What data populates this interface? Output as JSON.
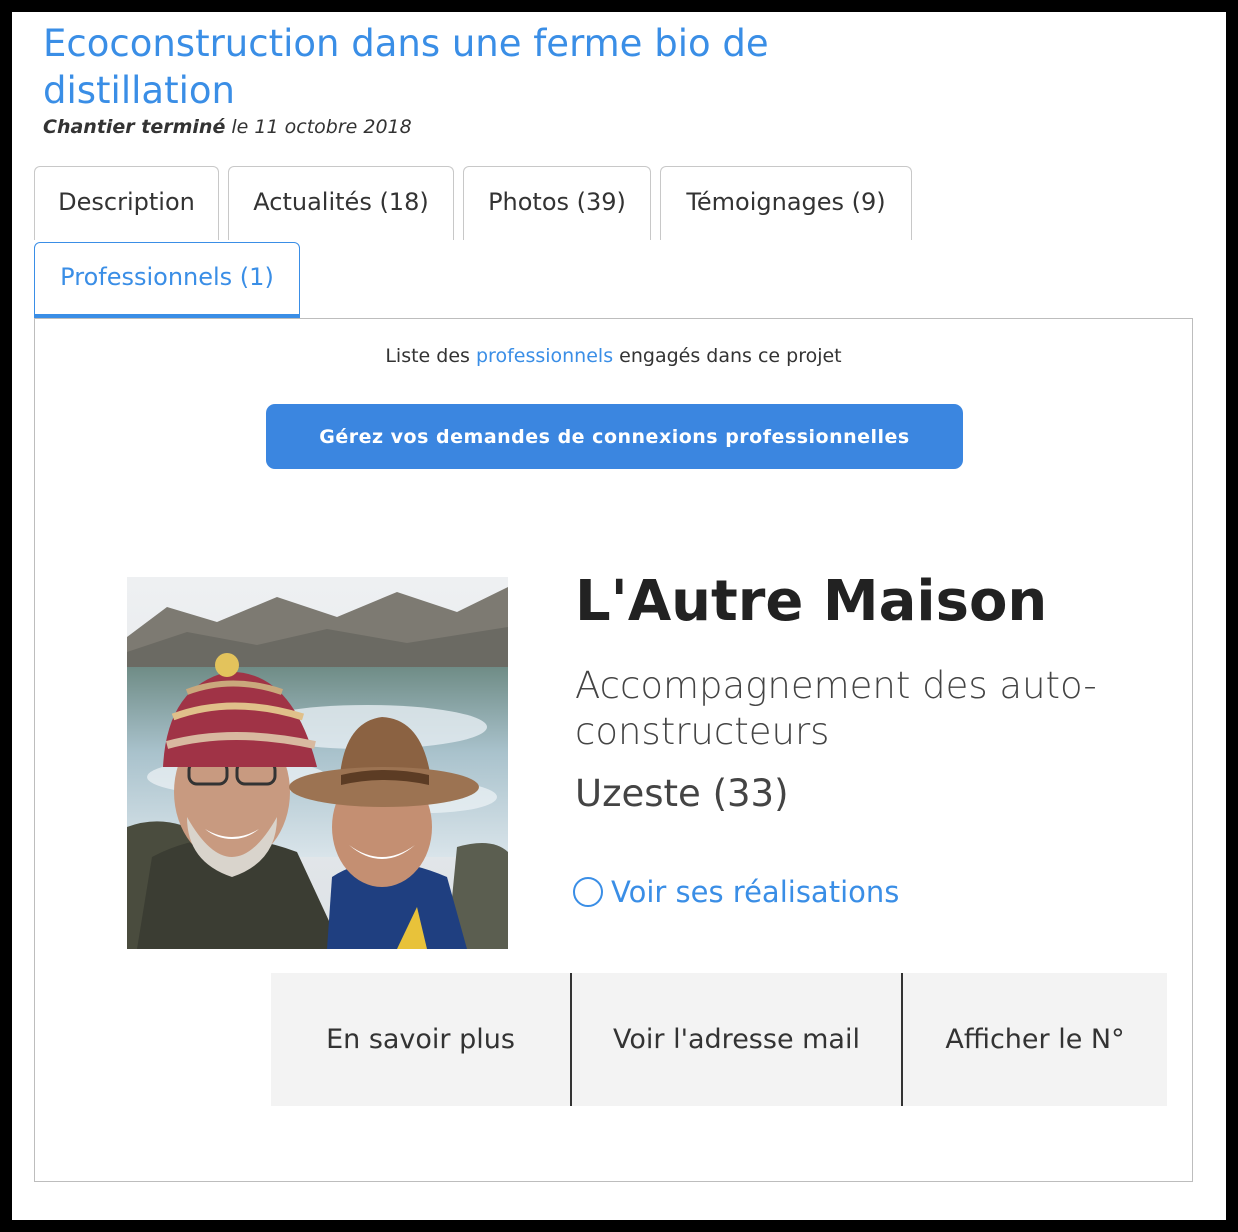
{
  "project": {
    "title": "Ecoconstruction dans une ferme bio de distillation",
    "status": "Chantier terminé",
    "date_text": "le 11 octobre 2018"
  },
  "tabs": [
    {
      "label": "Description",
      "active": false
    },
    {
      "label": "Actualités (18)",
      "active": false
    },
    {
      "label": "Photos (39)",
      "active": false
    },
    {
      "label": "Témoignages (9)",
      "active": false
    },
    {
      "label": "Professionnels (1)",
      "active": true
    }
  ],
  "panel": {
    "intro_before": "Liste des ",
    "intro_link": "professionnels",
    "intro_after": " engagés dans ce projet",
    "manage_button": "Gérez vos demandes de connexions professionnelles"
  },
  "professional": {
    "name": "L'Autre Maison",
    "activity": "Accompagnement des auto-constructeurs",
    "location": "Uzeste (33)",
    "realisations_link": "Voir ses réalisations",
    "realisations_icon": "circle-icon",
    "actions": {
      "more": "En savoir plus",
      "email": "Voir l'adresse mail",
      "phone": "Afficher le N°"
    }
  },
  "colors": {
    "accent": "#3a8ee6",
    "button": "#3b86e0",
    "action_bg": "#f3f3f3"
  }
}
